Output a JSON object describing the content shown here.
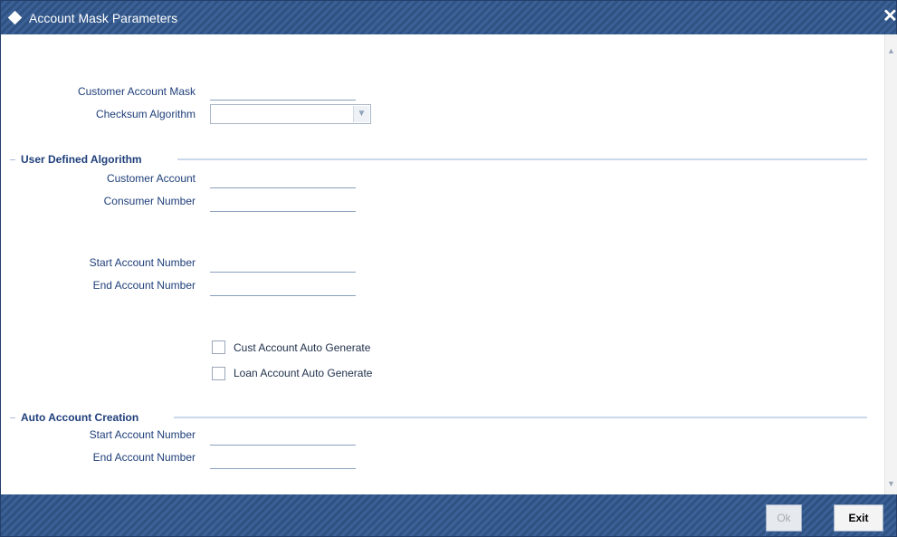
{
  "window": {
    "title": "Account Mask Parameters",
    "close_symbol": "✕"
  },
  "fields": {
    "customer_account_mask": {
      "label": "Customer Account Mask",
      "value": ""
    },
    "checksum_algorithm": {
      "label": "Checksum Algorithm",
      "value": ""
    }
  },
  "user_defined_algorithm": {
    "title": "User Defined Algorithm",
    "customer_account": {
      "label": "Customer Account",
      "value": ""
    },
    "consumer_number": {
      "label": "Consumer Number",
      "value": ""
    },
    "start_account_number": {
      "label": "Start Account Number",
      "value": ""
    },
    "end_account_number": {
      "label": "End Account Number",
      "value": ""
    },
    "cust_account_auto_generate": {
      "label": "Cust Account Auto Generate",
      "checked": false
    },
    "loan_account_auto_generate": {
      "label": "Loan Account Auto Generate",
      "checked": false
    }
  },
  "auto_account_creation": {
    "title": "Auto Account Creation",
    "start_account_number": {
      "label": "Start Account Number",
      "value": ""
    },
    "end_account_number": {
      "label": "End Account Number",
      "value": ""
    }
  },
  "footer": {
    "ok_label": "Ok",
    "exit_label": "Exit"
  },
  "icons": {
    "title": "diamond-icon",
    "close": "close-icon",
    "dropdown": "chevron-down-icon"
  },
  "colors": {
    "header_bg": "#2f5283",
    "label_text": "#1f3f7a",
    "section_line": "#c9d8ea"
  }
}
